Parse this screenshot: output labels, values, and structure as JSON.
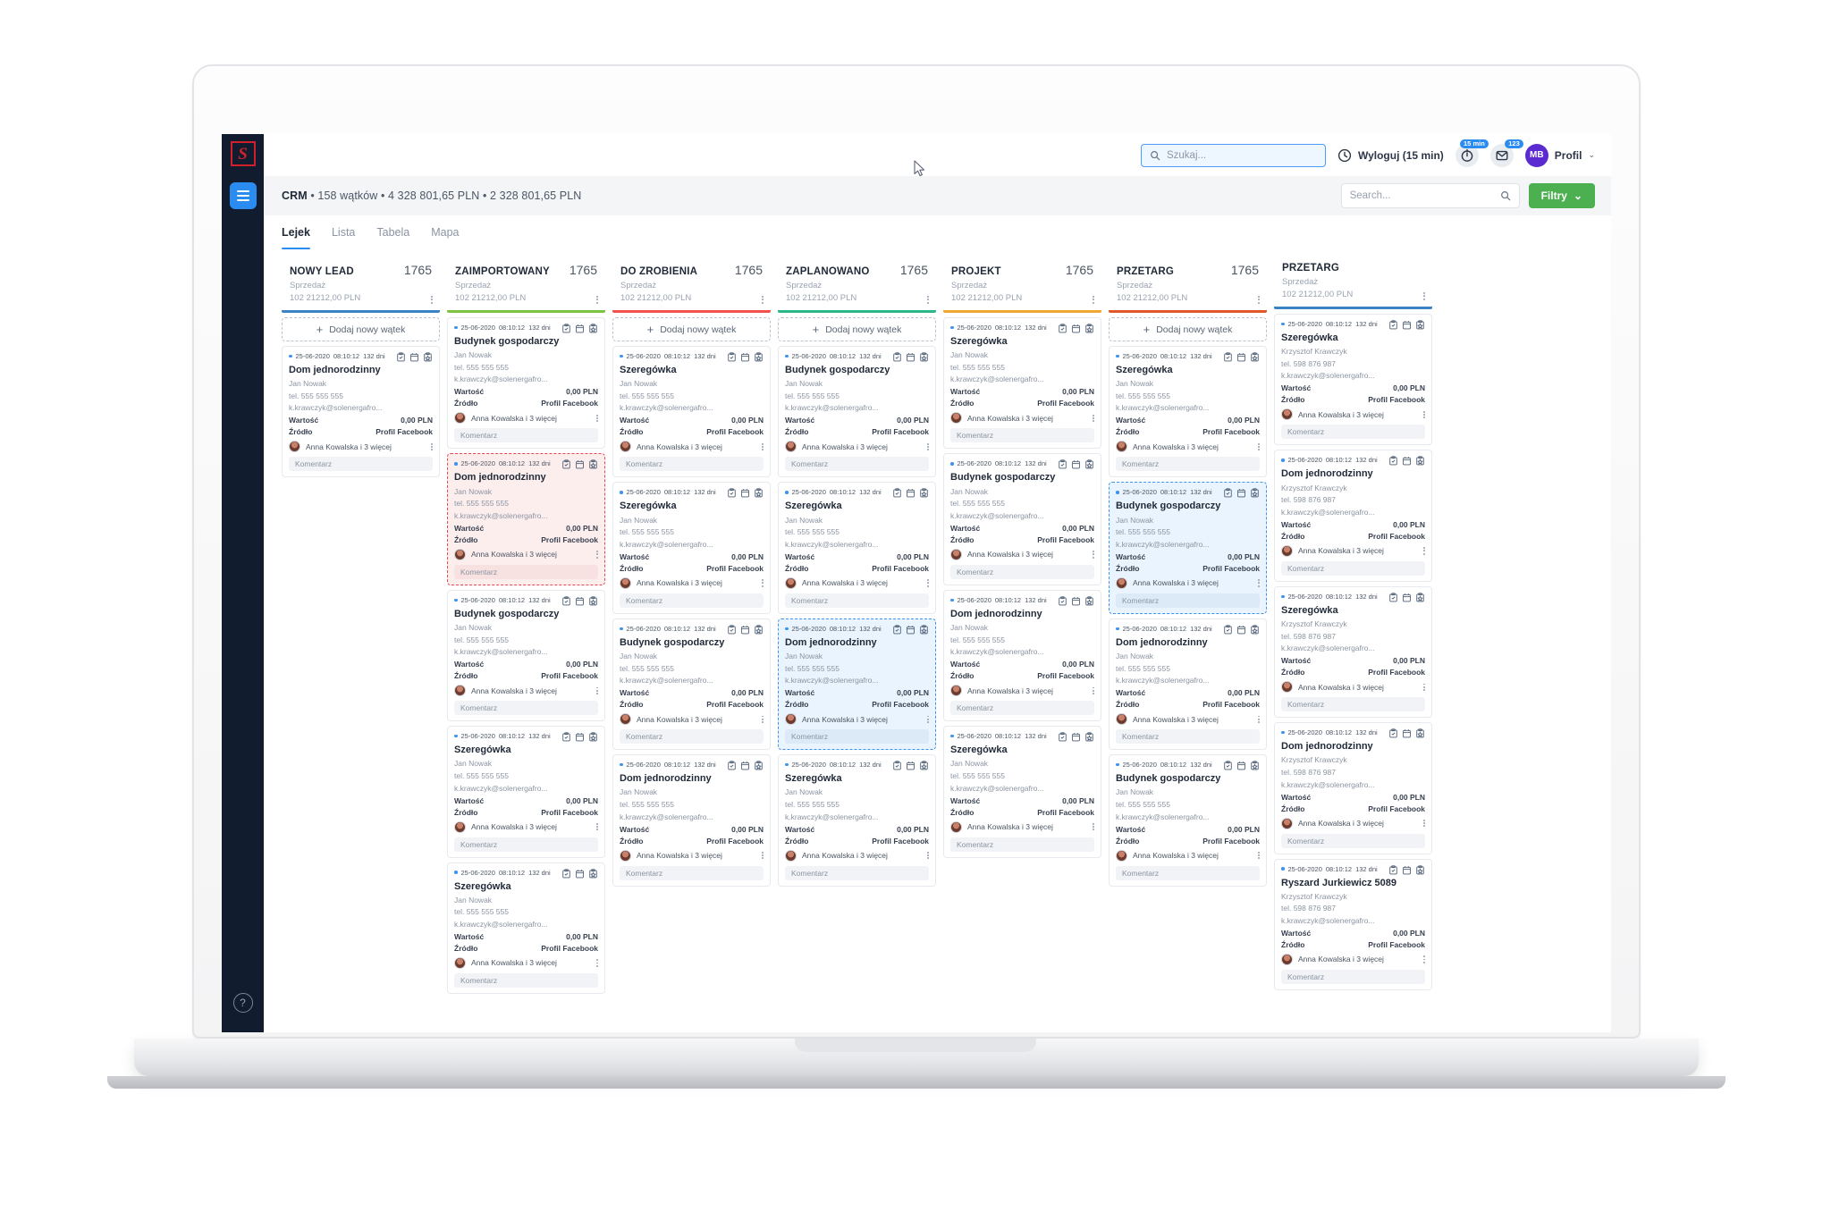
{
  "app": {
    "logo_glyph": "S",
    "help_label": "?"
  },
  "topbar": {
    "search_placeholder": "Szukaj...",
    "logout_label": "Wyloguj (15 min)",
    "timer_badge": "15 min",
    "mail_badge": "123",
    "avatar_initials": "MB",
    "profile_label": "Profil",
    "caret": "⌄"
  },
  "header": {
    "breadcrumb_title": "CRM",
    "breadcrumb_rest": "• 158 wątków • 4 328 801,65 PLN • 2 328 801,65 PLN",
    "search_placeholder": "Search...",
    "filters_label": "Filtry",
    "filters_caret": "⌄"
  },
  "tabs": [
    {
      "label": "Lejek",
      "active": true
    },
    {
      "label": "Lista",
      "active": false
    },
    {
      "label": "Tabela",
      "active": false
    },
    {
      "label": "Mapa",
      "active": false
    }
  ],
  "labels": {
    "add_thread": "Dodaj nowy wątek",
    "plus": "+",
    "value_key": "Wartość",
    "source_key": "Źródło",
    "comment_placeholder": "Komentarz",
    "dots": "⋮"
  },
  "card_defaults": {
    "date": "25-06-2020",
    "time": "08:10:12",
    "age": "132 dni",
    "value": "0,00 PLN",
    "source": "Profil Facebook",
    "assignee": "Anna Kowalska i 3 więcej",
    "contact_primary": "Jan Nowak",
    "phone_primary": "tel. 555 555 555",
    "email": "k.krawczyk@solenergafro...",
    "contact_secondary": "Krzysztof Krawczyk",
    "phone_secondary": "tel. 598 876 987"
  },
  "columns": [
    {
      "title": "NOWY LEAD",
      "count": "1765",
      "subtitle_1": "Sprzedaż",
      "subtitle_2": "102 21212,00 PLN",
      "bar_color": "#3b82c4",
      "add_first": true,
      "cards": [
        {
          "title": "Dom jednorodzinny",
          "contact": "Jan Nowak",
          "phone": "tel. 555 555 555",
          "highlight": "none"
        }
      ]
    },
    {
      "title": "ZAIMPORTOWANY",
      "count": "1765",
      "subtitle_1": "Sprzedaż",
      "subtitle_2": "102 21212,00 PLN",
      "bar_color": "#7ec242",
      "add_first": false,
      "cards": [
        {
          "title": "Budynek gospodarczy",
          "contact": "Jan Nowak",
          "phone": "tel. 555 555 555",
          "highlight": "none"
        },
        {
          "title": "Dom jednorodzinny",
          "contact": "Jan Nowak",
          "phone": "tel. 555 555 555",
          "highlight": "red"
        },
        {
          "title": "Budynek gospodarczy",
          "contact": "Jan Nowak",
          "phone": "tel. 555 555 555",
          "highlight": "none"
        },
        {
          "title": "Szeregówka",
          "contact": "Jan Nowak",
          "phone": "tel. 555 555 555",
          "highlight": "none"
        },
        {
          "title": "Szeregówka",
          "contact": "Jan Nowak",
          "phone": "tel. 555 555 555",
          "highlight": "none"
        }
      ]
    },
    {
      "title": "DO ZROBIENIA",
      "count": "1765",
      "subtitle_1": "Sprzedaż",
      "subtitle_2": "102 21212,00 PLN",
      "bar_color": "#f4504f",
      "add_first": true,
      "cards": [
        {
          "title": "Szeregówka",
          "contact": "Jan Nowak",
          "phone": "tel. 555 555 555",
          "highlight": "none"
        },
        {
          "title": "Szeregówka",
          "contact": "Jan Nowak",
          "phone": "tel. 555 555 555",
          "highlight": "none"
        },
        {
          "title": "Budynek gospodarczy",
          "contact": "Jan Nowak",
          "phone": "tel. 555 555 555",
          "highlight": "none"
        },
        {
          "title": "Dom jednorodzinny",
          "contact": "Jan Nowak",
          "phone": "tel. 555 555 555",
          "highlight": "none"
        }
      ]
    },
    {
      "title": "ZAPLANOWANO",
      "count": "1765",
      "subtitle_1": "Sprzedaż",
      "subtitle_2": "102 21212,00 PLN",
      "bar_color": "#2bb789",
      "add_first": true,
      "cards": [
        {
          "title": "Budynek gospodarczy",
          "contact": "Jan Nowak",
          "phone": "tel. 555 555 555",
          "highlight": "none"
        },
        {
          "title": "Szeregówka",
          "contact": "Jan Nowak",
          "phone": "tel. 555 555 555",
          "highlight": "none"
        },
        {
          "title": "Dom jednorodzinny",
          "contact": "Jan Nowak",
          "phone": "tel. 555 555 555",
          "highlight": "blue"
        },
        {
          "title": "Szeregówka",
          "contact": "Jan Nowak",
          "phone": "tel. 555 555 555",
          "highlight": "none"
        }
      ]
    },
    {
      "title": "PROJEKT",
      "count": "1765",
      "subtitle_1": "Sprzedaż",
      "subtitle_2": "102 21212,00 PLN",
      "bar_color": "#f2a634",
      "add_first": false,
      "cards": [
        {
          "title": "Szeregówka",
          "contact": "Jan Nowak",
          "phone": "tel. 555 555 555",
          "highlight": "none"
        },
        {
          "title": "Budynek gospodarczy",
          "contact": "Jan Nowak",
          "phone": "tel. 555 555 555",
          "highlight": "none"
        },
        {
          "title": "Dom jednorodzinny",
          "contact": "Jan Nowak",
          "phone": "tel. 555 555 555",
          "highlight": "none"
        },
        {
          "title": "Szeregówka",
          "contact": "Jan Nowak",
          "phone": "tel. 555 555 555",
          "highlight": "none"
        }
      ]
    },
    {
      "title": "PRZETARG",
      "count": "1765",
      "subtitle_1": "Sprzedaż",
      "subtitle_2": "102 21212,00 PLN",
      "bar_color": "#e0572a",
      "add_first": true,
      "cards": [
        {
          "title": "Szeregówka",
          "contact": "Jan Nowak",
          "phone": "tel. 555 555 555",
          "highlight": "none"
        },
        {
          "title": "Budynek gospodarczy",
          "contact": "Jan Nowak",
          "phone": "tel. 555 555 555",
          "highlight": "blue"
        },
        {
          "title": "Dom jednorodzinny",
          "contact": "Jan Nowak",
          "phone": "tel. 555 555 555",
          "highlight": "none"
        },
        {
          "title": "Budynek gospodarczy",
          "contact": "Jan Nowak",
          "phone": "tel. 555 555 555",
          "highlight": "none"
        }
      ]
    },
    {
      "title": "PRZETARG",
      "count": "",
      "subtitle_1": "Sprzedaż",
      "subtitle_2": "102 21212,00 PLN",
      "bar_color": "#3b82c4",
      "add_first": false,
      "cards": [
        {
          "title": "Szeregówka",
          "contact": "Krzysztof Krawczyk",
          "phone": "tel. 598 876 987",
          "highlight": "none"
        },
        {
          "title": "Dom jednorodzinny",
          "contact": "Krzysztof Krawczyk",
          "phone": "tel. 598 876 987",
          "highlight": "none"
        },
        {
          "title": "Szeregówka",
          "contact": "Krzysztof Krawczyk",
          "phone": "tel. 598 876 987",
          "highlight": "none"
        },
        {
          "title": "Dom jednorodzinny",
          "contact": "Krzysztof Krawczyk",
          "phone": "tel. 598 876 987",
          "highlight": "none"
        },
        {
          "title": "Ryszard Jurkiewicz 5089",
          "contact": "Krzysztof Krawczyk",
          "phone": "tel. 598 876 987",
          "highlight": "none"
        }
      ]
    }
  ]
}
